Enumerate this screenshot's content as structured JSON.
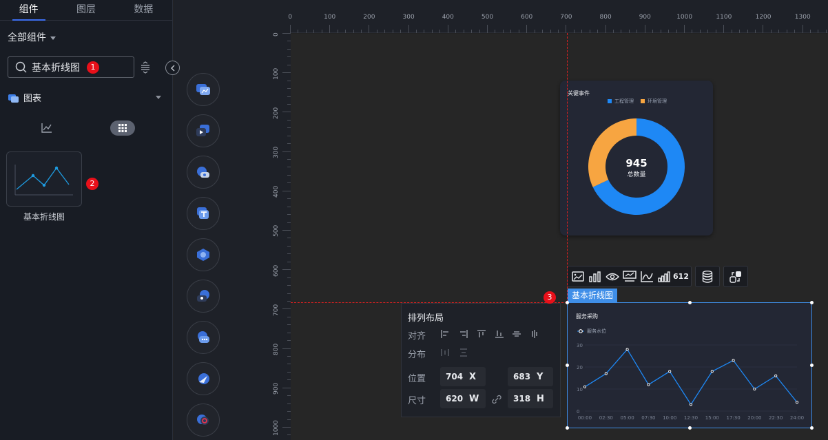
{
  "tabs": [
    {
      "label": "组件",
      "active": true
    },
    {
      "label": "图层",
      "active": false
    },
    {
      "label": "数据",
      "active": false
    }
  ],
  "filter_label": "全部组件",
  "search": {
    "value": "基本折线图",
    "badge": "1"
  },
  "category": {
    "label": "图表"
  },
  "component_card": {
    "label": "基本折线图",
    "badge": "2"
  },
  "rail_icons": [
    "chart-category-icon",
    "media-category-icon",
    "map-category-icon",
    "text-category-icon",
    "decoration-category-icon",
    "form-category-icon",
    "chat-category-icon",
    "nav-category-icon",
    "other-category-icon"
  ],
  "ruler": {
    "h_labels": [
      "0",
      "100",
      "200",
      "300",
      "400",
      "500",
      "600",
      "700",
      "800",
      "900",
      "1000",
      "1100",
      "1200",
      "1300"
    ],
    "v_labels": [
      "0",
      "100",
      "200",
      "300",
      "400",
      "500",
      "600",
      "700",
      "800",
      "900",
      "1000"
    ]
  },
  "donut": {
    "title": "关键事件",
    "legend": [
      {
        "name": "工程管理",
        "color": "#1e88f5"
      },
      {
        "name": "环境管理",
        "color": "#f7a541"
      }
    ],
    "center_value": "945",
    "center_label": "总数量",
    "slices": [
      {
        "name": "工程管理",
        "value": 0.68
      },
      {
        "name": "环境管理",
        "value": 0.32
      }
    ]
  },
  "toolbar": {
    "count_label": "612",
    "icons": [
      "image-chart-icon",
      "bar-chart-icon",
      "eye-icon",
      "display-icon",
      "line-chart-icon",
      "signal-icon",
      "number-icon",
      "database-icon",
      "swap-icon"
    ]
  },
  "selection": {
    "tag": "基本折线图",
    "badge": "3"
  },
  "chart_data": {
    "type": "line",
    "title": "服务采购",
    "series": [
      {
        "name": "服务水位",
        "color": "#1e88f5",
        "values": [
          11,
          17,
          28,
          12,
          18,
          3,
          18,
          23,
          10,
          16,
          4
        ]
      }
    ],
    "x": [
      "00:00",
      "02:30",
      "05:00",
      "07:30",
      "10:00",
      "12:30",
      "15:00",
      "17:30",
      "20:00",
      "22:30",
      "24:00"
    ],
    "yticks": [
      "0",
      "10",
      "20",
      "30"
    ],
    "ylim": [
      0,
      30
    ]
  },
  "layout_panel": {
    "title": "排列布局",
    "align_label": "对齐",
    "distribute_label": "分布",
    "position_label": "位置",
    "size_label": "尺寸",
    "x": {
      "value": "704",
      "unit": "X"
    },
    "y": {
      "value": "683",
      "unit": "Y"
    },
    "w": {
      "value": "620",
      "unit": "W"
    },
    "h": {
      "value": "318",
      "unit": "H"
    }
  }
}
